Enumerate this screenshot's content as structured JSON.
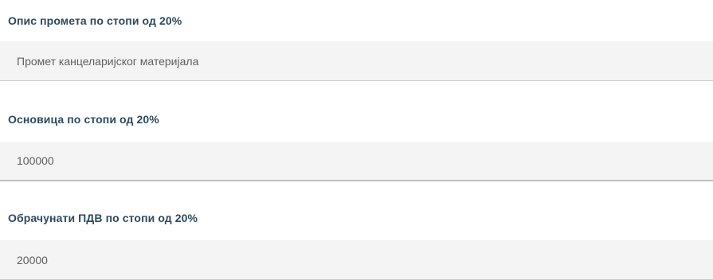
{
  "form": {
    "fields": [
      {
        "label": "Опис промета по стопи од 20%",
        "value": "Промет канцеларијског материјала"
      },
      {
        "label": "Основица по стопи од 20%",
        "value": "100000"
      },
      {
        "label": "Обрачунати ПДВ по стопи од 20%",
        "value": "20000"
      }
    ]
  },
  "colors": {
    "label": "#2b4a60",
    "input_background": "#f4f4f4",
    "input_text": "#5f5f5f",
    "input_border": "#c9c9c9"
  }
}
